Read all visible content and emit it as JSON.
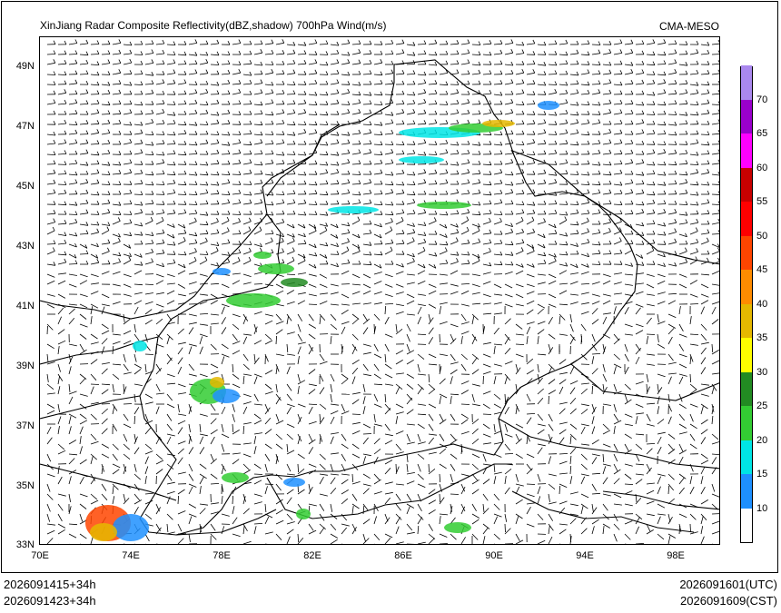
{
  "header": {
    "title": "XinJiang Radar Composite Reflectivity(dBZ,shadow) 700hPa Wind(m/s)",
    "source": "CMA-MESO"
  },
  "map": {
    "lat_labels": [
      "49N",
      "47N",
      "45N",
      "43N",
      "41N",
      "39N",
      "37N",
      "35N",
      "33N"
    ],
    "lon_labels": [
      "70E",
      "74E",
      "78E",
      "82E",
      "86E",
      "90E",
      "94E",
      "98E"
    ],
    "lat_range": [
      33,
      50
    ],
    "lon_range": [
      70,
      100
    ]
  },
  "colorbar": {
    "labels": [
      "10",
      "15",
      "20",
      "25",
      "30",
      "35",
      "40",
      "45",
      "50",
      "55",
      "60",
      "65",
      "70"
    ],
    "colors": [
      "#ffffff",
      "#1e90ff",
      "#00e5e5",
      "#33cc33",
      "#228b22",
      "#ffff00",
      "#e5b800",
      "#ff8c00",
      "#ff4500",
      "#ff0000",
      "#c80000",
      "#ff00ff",
      "#9900cc",
      "#aa88ee"
    ]
  },
  "footer": {
    "left_line1": "2026091415+34h",
    "left_line2": "2026091423+34h",
    "right_line1": "2026091601(UTC)",
    "right_line2": "2026091609(CST)"
  }
}
